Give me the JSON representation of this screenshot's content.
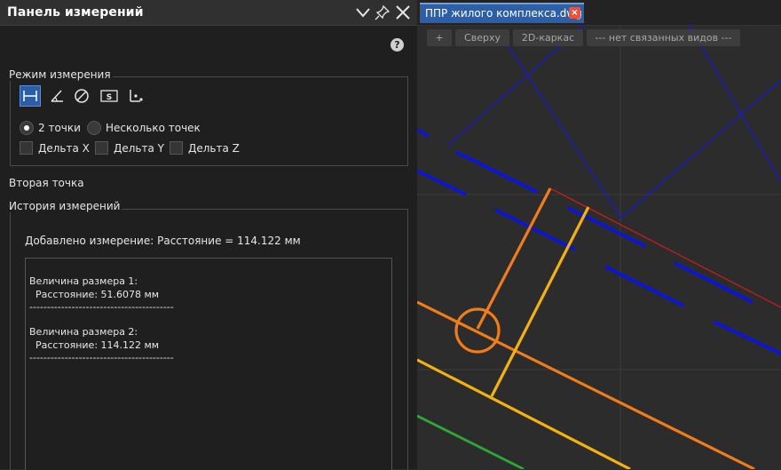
{
  "left_panel": {
    "title": "Панель измерений",
    "help": "?",
    "mode_group": {
      "label": "Режим измерения",
      "tools": [
        "distance-icon",
        "angle-icon",
        "diameter-icon",
        "area-icon",
        "coordinates-icon"
      ],
      "tool_s_text": "S",
      "radio_two": "2 точки",
      "radio_multi": "Несколько точек",
      "delta_x": "Дельта X",
      "delta_y": "Дельта Y",
      "delta_z": "Дельта Z"
    },
    "second_point": "Вторая точка",
    "history": {
      "label": "История измерений",
      "added": "Добавлено измерение: Расстояние = 114.122 мм",
      "lines": [
        "Величина размера 1:",
        "  Расстояние: 51.6078 мм",
        "-----------------------------------------",
        "Величина размера 2:",
        "  Расстояние: 114.122 мм",
        "-----------------------------------------"
      ]
    }
  },
  "doc": {
    "tab_title": "ППР жилого комплекса.dwg",
    "close": "×",
    "view_buttons": [
      "+",
      "Сверху",
      "2D-каркас",
      "--- нет связанных видов ---"
    ]
  },
  "colors": {
    "accent": "#2d5fa8",
    "blue_line": "#0a14e0",
    "orange": "#f07d1a",
    "yellow": "#f5b20f",
    "red": "#b81e1e",
    "green": "#2ea834"
  }
}
